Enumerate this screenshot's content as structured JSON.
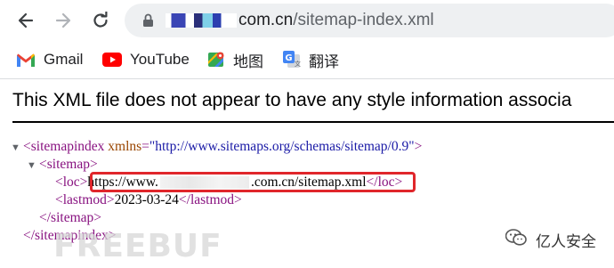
{
  "browser": {
    "url": {
      "host_suffix": "com.cn",
      "path": "/sitemap-index.xml"
    }
  },
  "bookmarks": [
    {
      "label": "Gmail",
      "icon": "gmail-icon"
    },
    {
      "label": "YouTube",
      "icon": "youtube-icon"
    },
    {
      "label": "地图",
      "icon": "maps-icon"
    },
    {
      "label": "翻译",
      "icon": "translate-icon"
    }
  ],
  "page": {
    "notice": "This XML file does not appear to have any style information associa",
    "xml": {
      "root_open": "<sitemapindex",
      "root_attr_name": "xmlns",
      "root_attr_value": "\"http://www.sitemaps.org/schemas/sitemap/0.9\"",
      "root_open_end": ">",
      "sitemap_open": "<sitemap>",
      "loc_open": "<loc>",
      "loc_prefix": "https://www.",
      "loc_suffix": ".com.cn/sitemap.xml",
      "loc_close": "</loc>",
      "lastmod_open": "<lastmod>",
      "lastmod_value": "2023-03-24",
      "lastmod_close": "</lastmod>",
      "sitemap_close": "</sitemap>",
      "root_close": "</sitemapindex>"
    }
  },
  "watermarks": {
    "left": "FREEBUF",
    "right": "亿人安全"
  },
  "colors": {
    "highlight_border": "#e0262b",
    "xml_tag": "#881280",
    "xml_attr_name": "#994500",
    "xml_attr_value": "#1a1aa6"
  }
}
